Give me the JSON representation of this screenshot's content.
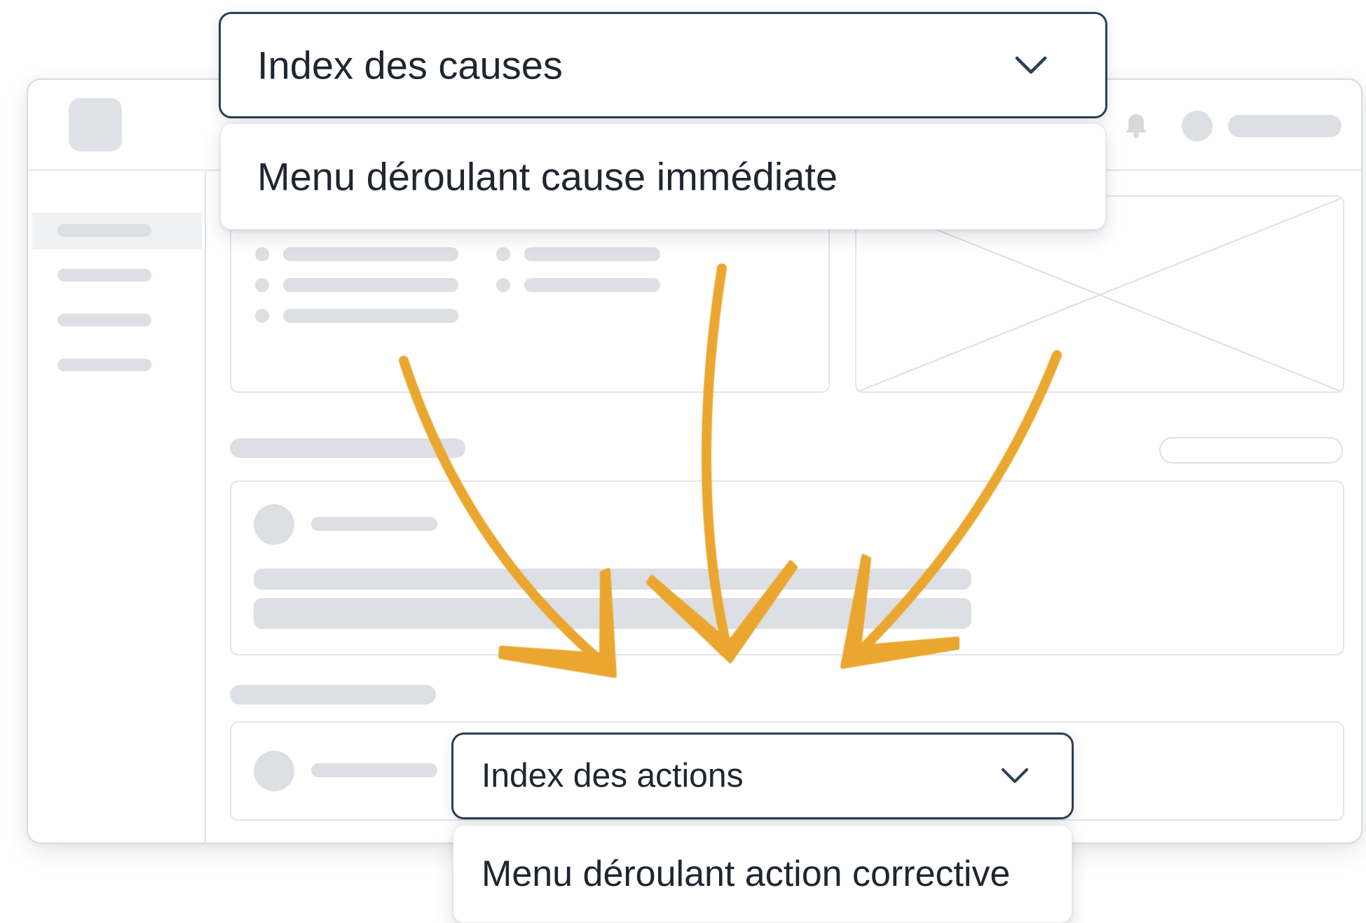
{
  "causes_selector": {
    "label": "Index des causes",
    "icon": "chevron-down-icon",
    "menu_items": [
      {
        "label": "Menu déroulant cause immédiate"
      }
    ]
  },
  "actions_selector": {
    "label": "Index des actions",
    "icon": "chevron-down-icon",
    "menu_items": [
      {
        "label": "Menu déroulant action corrective"
      }
    ]
  },
  "topbar": {
    "icons": [
      "bell-icon",
      "avatar"
    ]
  },
  "colors": {
    "dropdown_border": "#2b3f55",
    "arrow": "#eaa62e",
    "wireframe_gray": "#dcdfe4",
    "wireframe_border": "#e2e5ea"
  }
}
